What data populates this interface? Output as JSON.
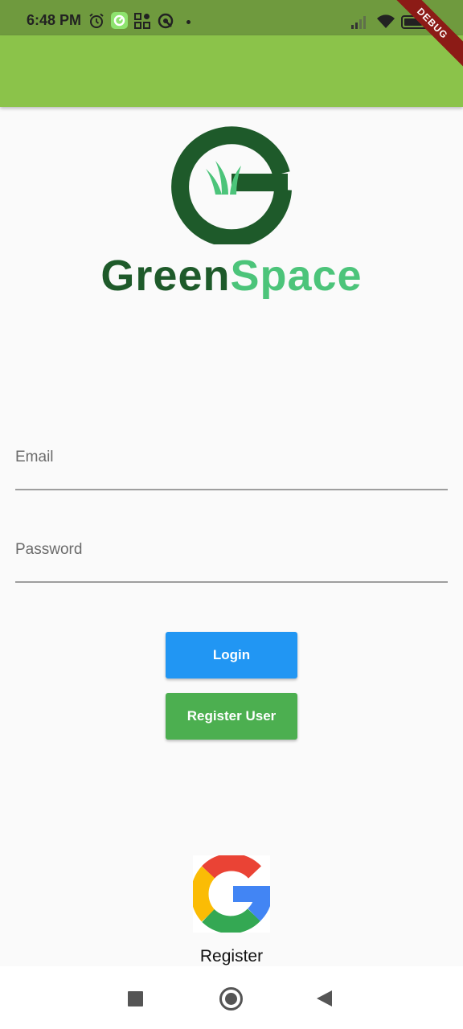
{
  "status_bar": {
    "time": "6:48 PM",
    "icons": [
      "alarm-icon",
      "green-app-icon",
      "grid-app-icon",
      "q-icon",
      "dot-icon",
      "signal-icon",
      "wifi-icon",
      "battery-icon"
    ]
  },
  "debug_banner": "DEBUG",
  "colors": {
    "app_bar": "#8bc34a",
    "status_bar": "#6f9a3e",
    "login_button": "#2196f3",
    "register_button": "#4caf50",
    "brand_dark": "#1e5a2a",
    "brand_light": "#4cc47a"
  },
  "brand": {
    "logo": "greenspace-logo-icon",
    "name_part1": "Green",
    "name_part2": "Space"
  },
  "form": {
    "email_label": "Email",
    "email_value": "",
    "password_label": "Password",
    "password_value": ""
  },
  "buttons": {
    "login": "Login",
    "register_user": "Register User"
  },
  "google": {
    "icon": "google-icon",
    "label": "Register"
  },
  "nav": {
    "icons": [
      "recents-icon",
      "home-icon",
      "back-icon"
    ]
  }
}
